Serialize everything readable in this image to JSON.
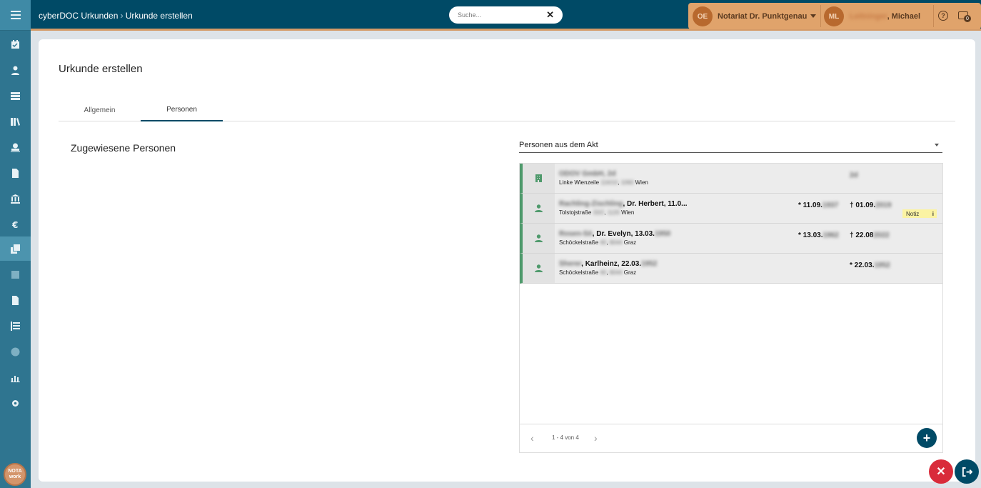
{
  "breadcrumb": {
    "app": "cyberDOC Urkunden",
    "page": "Urkunde erstellen"
  },
  "search": {
    "placeholder": "Suche..."
  },
  "header": {
    "office_initials": "OE",
    "office_name": "Notariat Dr. Punktgenau",
    "user_initials": "ML",
    "user_lastname_blurred": "Leitninger",
    "user_firstname": ", Michael",
    "help_icon": "?",
    "mail_count": "0"
  },
  "sidebar": {
    "items": [
      "menu-icon",
      "calendar-check-icon",
      "person-icon",
      "table-icon",
      "library-icon",
      "stamp-icon",
      "document-icon",
      "bank-icon",
      "euro-icon",
      "copy-icon",
      "square-icon",
      "file-icon",
      "list-icon",
      "info-icon",
      "chart-icon",
      "gear-icon"
    ],
    "logo_line1": "NOTA",
    "logo_line2": "work"
  },
  "main": {
    "title": "Urkunde erstellen",
    "tabs": [
      {
        "label": "Allgemein"
      },
      {
        "label": "Personen"
      }
    ],
    "assigned_label": "Zugewiesene Personen",
    "select_value": "Personen aus dem Akt"
  },
  "persons": [
    {
      "type": "company",
      "name_blur": "ODOV GmbH, 2d",
      "name": "",
      "addr_pre": "Linke Wienzeile",
      "addr_blur1": "116/10",
      "addr_blur2": "1060",
      "city": "Wien",
      "dob": "",
      "dob_blur": "",
      "dod": "",
      "dod_blur": "2d",
      "notiz": ""
    },
    {
      "type": "person",
      "name_blur": "Rachling-Zischling",
      "name": ", Dr. Herbert, 11.0...",
      "addr_pre": "Tolstojstraße",
      "addr_blur1": "33/2",
      "addr_blur2": "1120",
      "city": "Wien",
      "dob": "* 11.09.",
      "dob_blur": "1937",
      "dod": "† 01.09.",
      "dod_blur": "2019",
      "notiz": "Notiz"
    },
    {
      "type": "person",
      "name_blur": "Rosen-Sö",
      "name": ", Dr. Evelyn, 13.03.",
      "addr_pre": "Schöckelstraße",
      "addr_blur1": "40",
      "addr_blur2": "8044",
      "city": "Graz",
      "dob": "* 13.03.",
      "dob_blur": "1962",
      "dod": "† 22.08",
      "dod_blur": "2022",
      "notiz": ""
    },
    {
      "type": "person",
      "name_blur": "Sherer",
      "name": ", Karlheinz, 22.03.",
      "addr_pre": "Schöckelstraße",
      "addr_blur1": "40",
      "addr_blur2": "8044",
      "city": "Graz",
      "dob": "* 22.03.",
      "dob_blur": "1952",
      "dod": "",
      "dod_blur": "",
      "notiz": ""
    }
  ],
  "pager": {
    "text": "1 - 4 von 4"
  }
}
